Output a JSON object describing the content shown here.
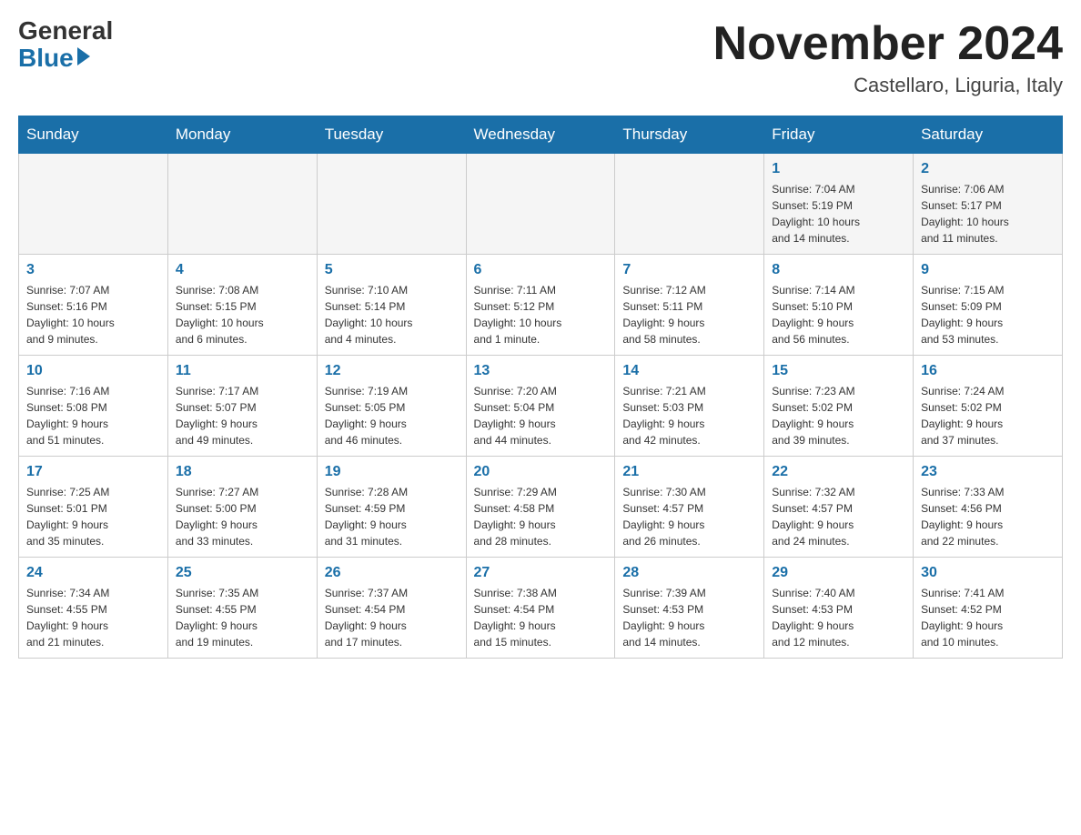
{
  "header": {
    "logo_general": "General",
    "logo_blue": "Blue",
    "title": "November 2024",
    "subtitle": "Castellaro, Liguria, Italy"
  },
  "weekdays": [
    "Sunday",
    "Monday",
    "Tuesday",
    "Wednesday",
    "Thursday",
    "Friday",
    "Saturday"
  ],
  "weeks": [
    [
      {
        "day": "",
        "info": ""
      },
      {
        "day": "",
        "info": ""
      },
      {
        "day": "",
        "info": ""
      },
      {
        "day": "",
        "info": ""
      },
      {
        "day": "",
        "info": ""
      },
      {
        "day": "1",
        "info": "Sunrise: 7:04 AM\nSunset: 5:19 PM\nDaylight: 10 hours\nand 14 minutes."
      },
      {
        "day": "2",
        "info": "Sunrise: 7:06 AM\nSunset: 5:17 PM\nDaylight: 10 hours\nand 11 minutes."
      }
    ],
    [
      {
        "day": "3",
        "info": "Sunrise: 7:07 AM\nSunset: 5:16 PM\nDaylight: 10 hours\nand 9 minutes."
      },
      {
        "day": "4",
        "info": "Sunrise: 7:08 AM\nSunset: 5:15 PM\nDaylight: 10 hours\nand 6 minutes."
      },
      {
        "day": "5",
        "info": "Sunrise: 7:10 AM\nSunset: 5:14 PM\nDaylight: 10 hours\nand 4 minutes."
      },
      {
        "day": "6",
        "info": "Sunrise: 7:11 AM\nSunset: 5:12 PM\nDaylight: 10 hours\nand 1 minute."
      },
      {
        "day": "7",
        "info": "Sunrise: 7:12 AM\nSunset: 5:11 PM\nDaylight: 9 hours\nand 58 minutes."
      },
      {
        "day": "8",
        "info": "Sunrise: 7:14 AM\nSunset: 5:10 PM\nDaylight: 9 hours\nand 56 minutes."
      },
      {
        "day": "9",
        "info": "Sunrise: 7:15 AM\nSunset: 5:09 PM\nDaylight: 9 hours\nand 53 minutes."
      }
    ],
    [
      {
        "day": "10",
        "info": "Sunrise: 7:16 AM\nSunset: 5:08 PM\nDaylight: 9 hours\nand 51 minutes."
      },
      {
        "day": "11",
        "info": "Sunrise: 7:17 AM\nSunset: 5:07 PM\nDaylight: 9 hours\nand 49 minutes."
      },
      {
        "day": "12",
        "info": "Sunrise: 7:19 AM\nSunset: 5:05 PM\nDaylight: 9 hours\nand 46 minutes."
      },
      {
        "day": "13",
        "info": "Sunrise: 7:20 AM\nSunset: 5:04 PM\nDaylight: 9 hours\nand 44 minutes."
      },
      {
        "day": "14",
        "info": "Sunrise: 7:21 AM\nSunset: 5:03 PM\nDaylight: 9 hours\nand 42 minutes."
      },
      {
        "day": "15",
        "info": "Sunrise: 7:23 AM\nSunset: 5:02 PM\nDaylight: 9 hours\nand 39 minutes."
      },
      {
        "day": "16",
        "info": "Sunrise: 7:24 AM\nSunset: 5:02 PM\nDaylight: 9 hours\nand 37 minutes."
      }
    ],
    [
      {
        "day": "17",
        "info": "Sunrise: 7:25 AM\nSunset: 5:01 PM\nDaylight: 9 hours\nand 35 minutes."
      },
      {
        "day": "18",
        "info": "Sunrise: 7:27 AM\nSunset: 5:00 PM\nDaylight: 9 hours\nand 33 minutes."
      },
      {
        "day": "19",
        "info": "Sunrise: 7:28 AM\nSunset: 4:59 PM\nDaylight: 9 hours\nand 31 minutes."
      },
      {
        "day": "20",
        "info": "Sunrise: 7:29 AM\nSunset: 4:58 PM\nDaylight: 9 hours\nand 28 minutes."
      },
      {
        "day": "21",
        "info": "Sunrise: 7:30 AM\nSunset: 4:57 PM\nDaylight: 9 hours\nand 26 minutes."
      },
      {
        "day": "22",
        "info": "Sunrise: 7:32 AM\nSunset: 4:57 PM\nDaylight: 9 hours\nand 24 minutes."
      },
      {
        "day": "23",
        "info": "Sunrise: 7:33 AM\nSunset: 4:56 PM\nDaylight: 9 hours\nand 22 minutes."
      }
    ],
    [
      {
        "day": "24",
        "info": "Sunrise: 7:34 AM\nSunset: 4:55 PM\nDaylight: 9 hours\nand 21 minutes."
      },
      {
        "day": "25",
        "info": "Sunrise: 7:35 AM\nSunset: 4:55 PM\nDaylight: 9 hours\nand 19 minutes."
      },
      {
        "day": "26",
        "info": "Sunrise: 7:37 AM\nSunset: 4:54 PM\nDaylight: 9 hours\nand 17 minutes."
      },
      {
        "day": "27",
        "info": "Sunrise: 7:38 AM\nSunset: 4:54 PM\nDaylight: 9 hours\nand 15 minutes."
      },
      {
        "day": "28",
        "info": "Sunrise: 7:39 AM\nSunset: 4:53 PM\nDaylight: 9 hours\nand 14 minutes."
      },
      {
        "day": "29",
        "info": "Sunrise: 7:40 AM\nSunset: 4:53 PM\nDaylight: 9 hours\nand 12 minutes."
      },
      {
        "day": "30",
        "info": "Sunrise: 7:41 AM\nSunset: 4:52 PM\nDaylight: 9 hours\nand 10 minutes."
      }
    ]
  ]
}
